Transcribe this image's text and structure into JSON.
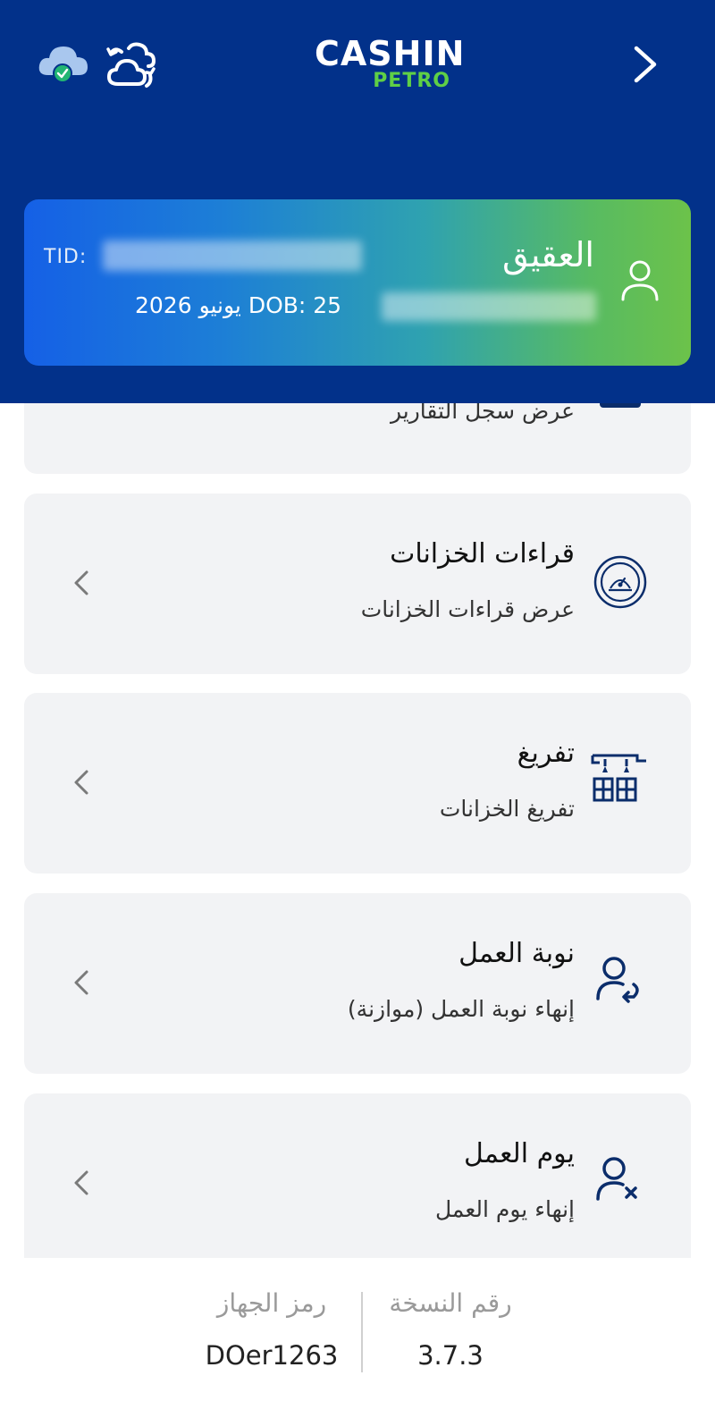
{
  "header": {
    "logo_main": "CASHIN",
    "logo_sub": "PETRO",
    "icons": [
      "cloud-check-icon",
      "cloud-sync-icon",
      "chevron-right-icon"
    ]
  },
  "station": {
    "name": "العقيق",
    "tid_label": "TID:",
    "dob_text": "DOB: 25 يونيو 2026"
  },
  "cards": [
    {
      "title": "",
      "subtitle": "عرض سجل التقارير",
      "icon": "report-icon"
    },
    {
      "title": "قراءات الخزانات",
      "subtitle": "عرض قراءات الخزانات",
      "icon": "gauge-icon"
    },
    {
      "title": "تفريغ",
      "subtitle": "تفريغ الخزانات",
      "icon": "tank-unload-icon"
    },
    {
      "title": "نوبة العمل",
      "subtitle": "إنهاء نوبة العمل (موازنة)",
      "icon": "user-shift-icon"
    },
    {
      "title": "يوم العمل",
      "subtitle": "إنهاء يوم العمل",
      "icon": "user-end-day-icon"
    }
  ],
  "footer": {
    "version_label": "رقم النسخة",
    "version_value": "3.7.3",
    "device_label": "رمز الجهاز",
    "device_value": "DOer1263"
  },
  "colors": {
    "header_bg": "#02318a",
    "accent_green": "#5fcf46",
    "icon_navy": "#0b2d6b",
    "card_bg": "#f2f3f5"
  }
}
